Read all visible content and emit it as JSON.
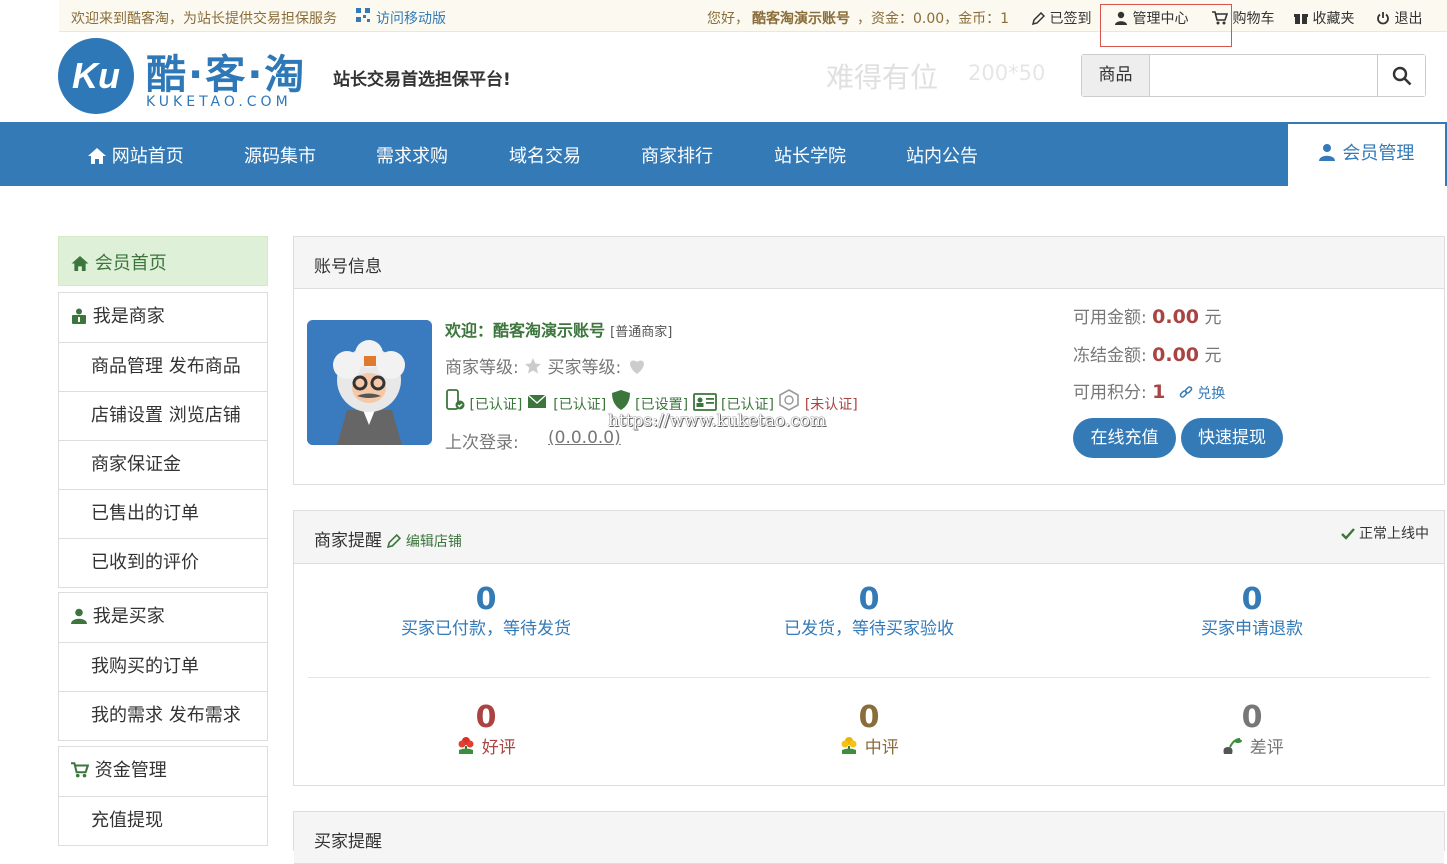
{
  "topbar": {
    "welcome": "欢迎来到酷客淘，为站长提供交易担保服务",
    "mobile": "访问移动版",
    "greeting_prefix": "您好，",
    "account": "酷客淘演示账号",
    "funds": "，资金：0.00，金币：1",
    "signed": "已签到",
    "admin": "管理中心",
    "cart": "购物车",
    "favorites": "收藏夹",
    "logout": "退出"
  },
  "logo": {
    "mark": "Ku",
    "name": "酷·客·淘",
    "sub": "KUKETAO.COM"
  },
  "slogan": "站长交易首选担保平台!",
  "ad": {
    "text": "难得有位",
    "size": "200*50"
  },
  "search": {
    "category": "商品",
    "value": ""
  },
  "nav": {
    "items": [
      "网站首页",
      "源码集市",
      "需求求购",
      "域名交易",
      "商家排行",
      "站长学院",
      "站内公告"
    ],
    "active": "会员管理"
  },
  "sidebar": {
    "home": "会员首页",
    "seller": {
      "title": "我是商家",
      "items": [
        "商品管理 发布商品",
        "店铺设置 浏览店铺",
        "商家保证金",
        "已售出的订单",
        "已收到的评价"
      ]
    },
    "buyer": {
      "title": "我是买家",
      "items": [
        "我购买的订单",
        "我的需求 发布需求"
      ]
    },
    "funds": {
      "title": "资金管理",
      "items": [
        "充值提现"
      ]
    }
  },
  "account_panel": {
    "title": "账号信息",
    "welcome_prefix": "欢迎：",
    "name": "酷客淘演示账号",
    "level_tag": "[普通商家]",
    "seller_level": "商家等级:",
    "buyer_level": "买家等级:",
    "certs": [
      "[已认证]",
      "[已认证]",
      "[已设置]",
      "[已认证]",
      "[未认证]"
    ],
    "last_login_label": "上次登录:",
    "last_login_value": "(0.0.0.0)",
    "watermark": "https://www.kuketao.com",
    "available_label": "可用金额:",
    "available_value": "0.00",
    "frozen_label": "冻结金额:",
    "frozen_value": "0.00",
    "unit": "元",
    "points_label": "可用积分:",
    "points_value": "1",
    "exchange": "兑换",
    "recharge_btn": "在线充值",
    "withdraw_btn": "快速提现"
  },
  "seller_panel": {
    "title": "商家提醒",
    "edit": "编辑店铺",
    "status": "正常上线中",
    "stats": [
      {
        "value": "0",
        "label": "买家已付款，等待发货"
      },
      {
        "value": "0",
        "label": "已发货，等待买家验收"
      },
      {
        "value": "0",
        "label": "买家申请退款"
      }
    ],
    "reviews": [
      {
        "value": "0",
        "label": "好评"
      },
      {
        "value": "0",
        "label": "中评"
      },
      {
        "value": "0",
        "label": "差评"
      }
    ]
  },
  "buyer_panel": {
    "title": "买家提醒"
  },
  "colors": {
    "brand": "#337ab7",
    "red": "#a94442",
    "green": "#3c763d",
    "gold": "#8a6d3b"
  }
}
